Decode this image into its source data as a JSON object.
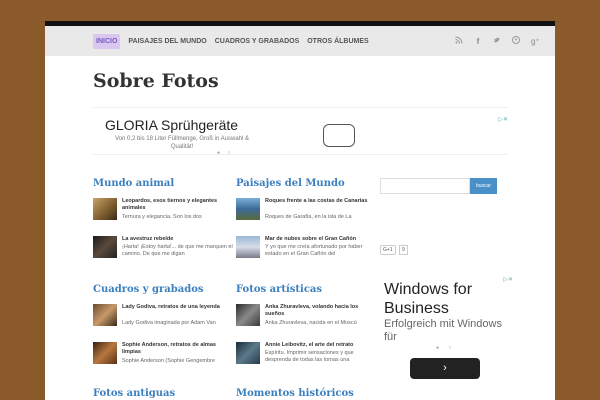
{
  "nav": {
    "items": [
      "INICIO",
      "PAISAJES DEL MUNDO",
      "CUADROS Y GRABADOS",
      "OTROS ÁLBUMES"
    ]
  },
  "social": {
    "icons": [
      "rss-icon",
      "facebook-icon",
      "twitter-icon",
      "pinterest-icon",
      "google-plus-icon"
    ]
  },
  "site": {
    "title": "Sobre Fotos"
  },
  "ad_top": {
    "headline": "GLORIA Sprühgeräte",
    "subtext": "Von 0,2 bis 18 Liter Füllmenge, Groß in Auswahl & Qualität!"
  },
  "sections": {
    "mundo_animal": {
      "title": "Mundo animal",
      "posts": [
        {
          "title": "Leopardos, esos tiernos y elegantes animales",
          "excerpt": "Ternura y elegancia. Son los dos"
        },
        {
          "title": "La avestruz rebelde",
          "excerpt": "¡Harta! ¡Estoy harta!... de que me marquen el camino. De que me digan"
        }
      ]
    },
    "paisajes": {
      "title": "Paisajes del Mundo",
      "posts": [
        {
          "title": "Roques frente a las costas de Canarias",
          "excerpt": "Roques de Garafía, en la isla de La"
        },
        {
          "title": "Mar de nubes sobre el Gran Cañón",
          "excerpt": "Y yo que me creía afortunado por haber estado en el Gran Cañón del"
        }
      ]
    },
    "cuadros": {
      "title": "Cuadros y grabados",
      "posts": [
        {
          "title": "Lady Godiva, retratos de una leyenda",
          "excerpt": "Lady Godiva imaginada por Adam Van"
        },
        {
          "title": "Sophie Anderson, retratos de almas limpias",
          "excerpt": "Sophie Anderson (Sophie Gengembre"
        }
      ]
    },
    "artisticas": {
      "title": "Fotos artísticas",
      "posts": [
        {
          "title": "Anka Zhuravleva, volando hacia los sueños",
          "excerpt": "Anka Zhuravleva, nacida en el Moscú"
        },
        {
          "title": "Annie Leibovitz, el arte del retrato",
          "excerpt": "Espíritu. Imprimir sensaciones y que desprenda de todas las tomas una"
        }
      ]
    },
    "antiguas": {
      "title": "Fotos antiguas"
    },
    "historicos": {
      "title": "Momentos históricos"
    }
  },
  "sidebar": {
    "search_placeholder": "",
    "search_label": "buscar",
    "gplus_label": "G+1",
    "gplus_count": "9"
  },
  "ad_side": {
    "headline": "Windows for Business",
    "subtext": "Erfolgreich mit Windows für",
    "next_icon": "›"
  },
  "colors": {
    "background": "#8a5a2b",
    "accent": "#3a7fbf",
    "nav_active": "#d9c7f0"
  }
}
